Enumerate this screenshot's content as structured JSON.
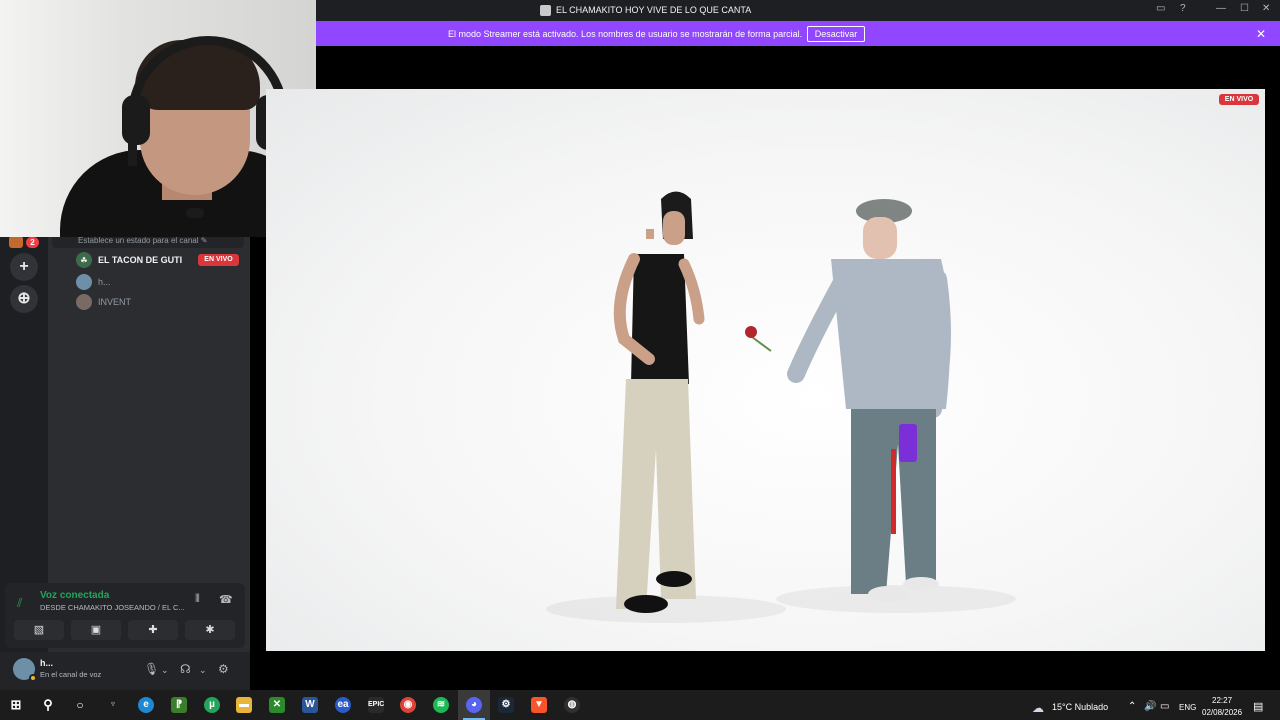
{
  "window": {
    "title": "EL CHAMAKITO HOY VIVE DE LO QUE CANTA"
  },
  "streamer_bar": {
    "message": "El modo Streamer está activado. Los nombres de usuario se mostrarán de forma parcial.",
    "button_label": "Desactivar",
    "color": "#9146ff"
  },
  "server_rail": {
    "badge_count": "2",
    "add_label": "+",
    "discover_label": "⊕"
  },
  "channel": {
    "status_placeholder": "Establece un estado para el canal",
    "voice_users": [
      {
        "name": "EL TACON DE GUTI",
        "live": true
      },
      {
        "name": "h...",
        "live": false
      },
      {
        "name": "INVENT",
        "live": false
      }
    ],
    "live_badge": "EN VIVO"
  },
  "voice_panel": {
    "title": "Voz conectada",
    "subtitle": "DESDE CHAMAKITO JOSEANDO / EL C...",
    "accent": "#23a55a"
  },
  "user_panel": {
    "name": "h...",
    "status": "En el canal de voz"
  },
  "video": {
    "live_badge": "EN VIVO"
  },
  "taskbar": {
    "weather": "15°C  Nublado",
    "language": "ENG",
    "time": "22:27",
    "date": "02/08/2026",
    "apps": [
      "start",
      "search",
      "cortana",
      "game",
      "edge",
      "utorrent",
      "files",
      "xbox",
      "word",
      "ea",
      "epic",
      "chrome",
      "spotify",
      "discord",
      "steam",
      "brave",
      "obs"
    ]
  }
}
